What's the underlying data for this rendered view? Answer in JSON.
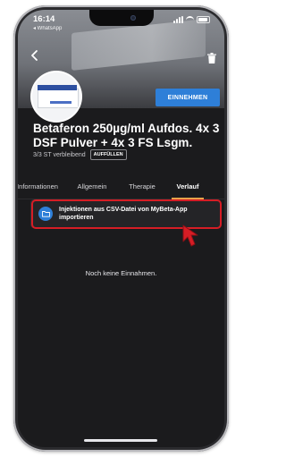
{
  "status_bar": {
    "time": "16:14",
    "back_app": "◂ WhatsApp"
  },
  "product": {
    "title": "Betaferon 250µg/ml Aufdos. 4x 3 DSF Pulver + 4x 3 FS Lsgm.",
    "remaining": "3/3 ST verbleibend",
    "refill_label": "AUFFÜLLEN",
    "take_label": "EINNEHMEN"
  },
  "tabs": [
    {
      "label": "Informationen",
      "active": false
    },
    {
      "label": "Allgemein",
      "active": false
    },
    {
      "label": "Therapie",
      "active": false
    },
    {
      "label": "Verlauf",
      "active": true
    }
  ],
  "history": {
    "import_label": "Injektionen aus CSV-Datei von MyBeta-App importieren",
    "empty_text": "Noch keine Einnahmen."
  },
  "colors": {
    "accent_blue": "#2e7fd8",
    "tab_underline": "#e8a24a",
    "highlight_red": "#d61d25",
    "background": "#1b1b1d"
  },
  "icons": {
    "back": "chevron-left-icon",
    "delete": "trash-icon",
    "import": "folder-icon",
    "pointer": "cursor-arrow-icon"
  }
}
